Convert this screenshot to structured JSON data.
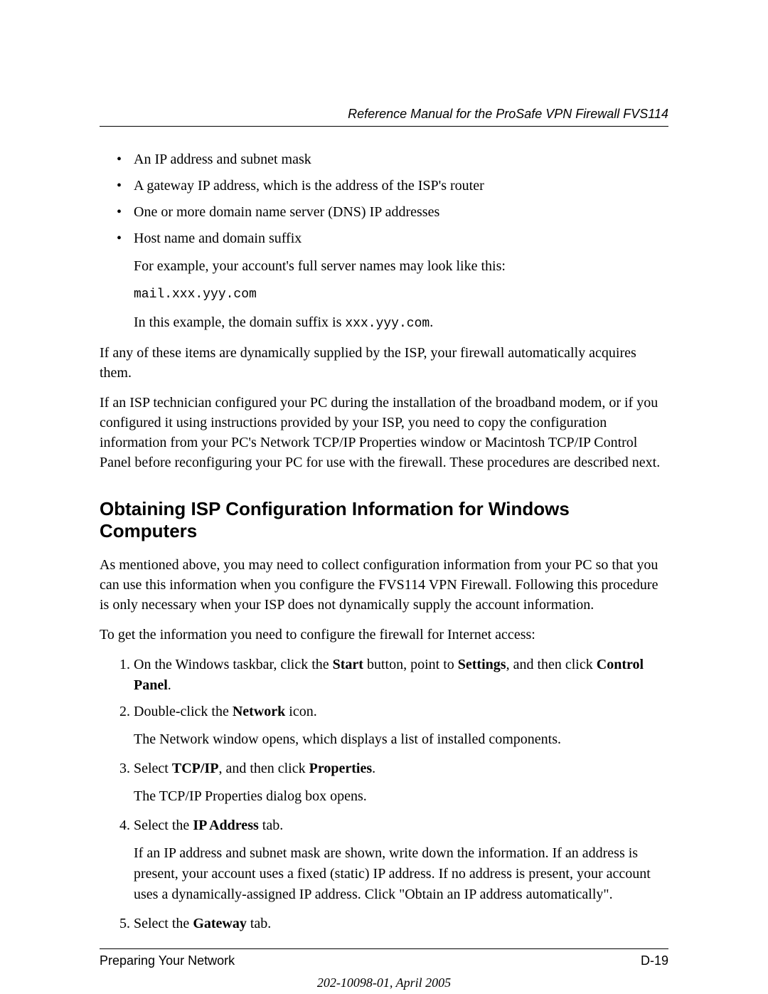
{
  "header": {
    "running_title": "Reference Manual for the ProSafe VPN Firewall FVS114"
  },
  "bullets": [
    "An IP address and subnet mask",
    "A gateway IP address, which is the address of the ISP's router",
    "One or more domain name server (DNS) IP addresses",
    "Host name and domain suffix"
  ],
  "example": {
    "intro": "For example, your account's full server names may look like this:",
    "server": "mail.xxx.yyy.com",
    "explain_prefix": "In this example, the domain suffix is ",
    "suffix_code": "xxx.yyy.com",
    "explain_suffix": "."
  },
  "paragraphs": {
    "p1": "If any of these items are dynamically supplied by the ISP, your firewall automatically acquires them.",
    "p2": "If an ISP technician configured your PC during the installation of the broadband modem, or if you configured it using instructions provided by your ISP, you need to copy the configuration information from your PC's Network TCP/IP Properties window or Macintosh TCP/IP Control Panel before reconfiguring your PC for use with the firewall. These procedures are described next."
  },
  "section_heading": "Obtaining ISP Configuration Information for Windows Computers",
  "section_intro": "As mentioned above, you may need to collect configuration information from your PC so that you can use this information when you configure the FVS114 VPN Firewall. Following this procedure is only necessary when your ISP does not dynamically supply the account information.",
  "section_lead": "To get the information you need to configure the firewall for Internet access:",
  "steps": {
    "s1": {
      "t1": "On the Windows taskbar, click the ",
      "b1": "Start",
      "t2": " button, point to ",
      "b2": "Settings",
      "t3": ", and then click ",
      "b3": "Control Panel",
      "t4": "."
    },
    "s2": {
      "t1": "Double-click the ",
      "b1": "Network",
      "t2": " icon.",
      "sub": "The Network window opens, which displays a list of installed components."
    },
    "s3": {
      "t1": "Select ",
      "b1": "TCP/IP",
      "t2": ", and then click ",
      "b2": "Properties",
      "t3": ".",
      "sub": "The TCP/IP Properties dialog box opens."
    },
    "s4": {
      "t1": "Select the ",
      "b1": "IP Address",
      "t2": " tab.",
      "sub": "If an IP address and subnet mask are shown, write down the information. If an address is present, your account uses a fixed (static) IP address. If no address is present, your account uses a dynamically-assigned IP address. Click \"Obtain an IP address automatically\"."
    },
    "s5": {
      "t1": "Select the ",
      "b1": "Gateway",
      "t2": " tab."
    }
  },
  "footer": {
    "section": "Preparing Your Network",
    "page": "D-19",
    "docnum": "202-10098-01, April 2005"
  }
}
